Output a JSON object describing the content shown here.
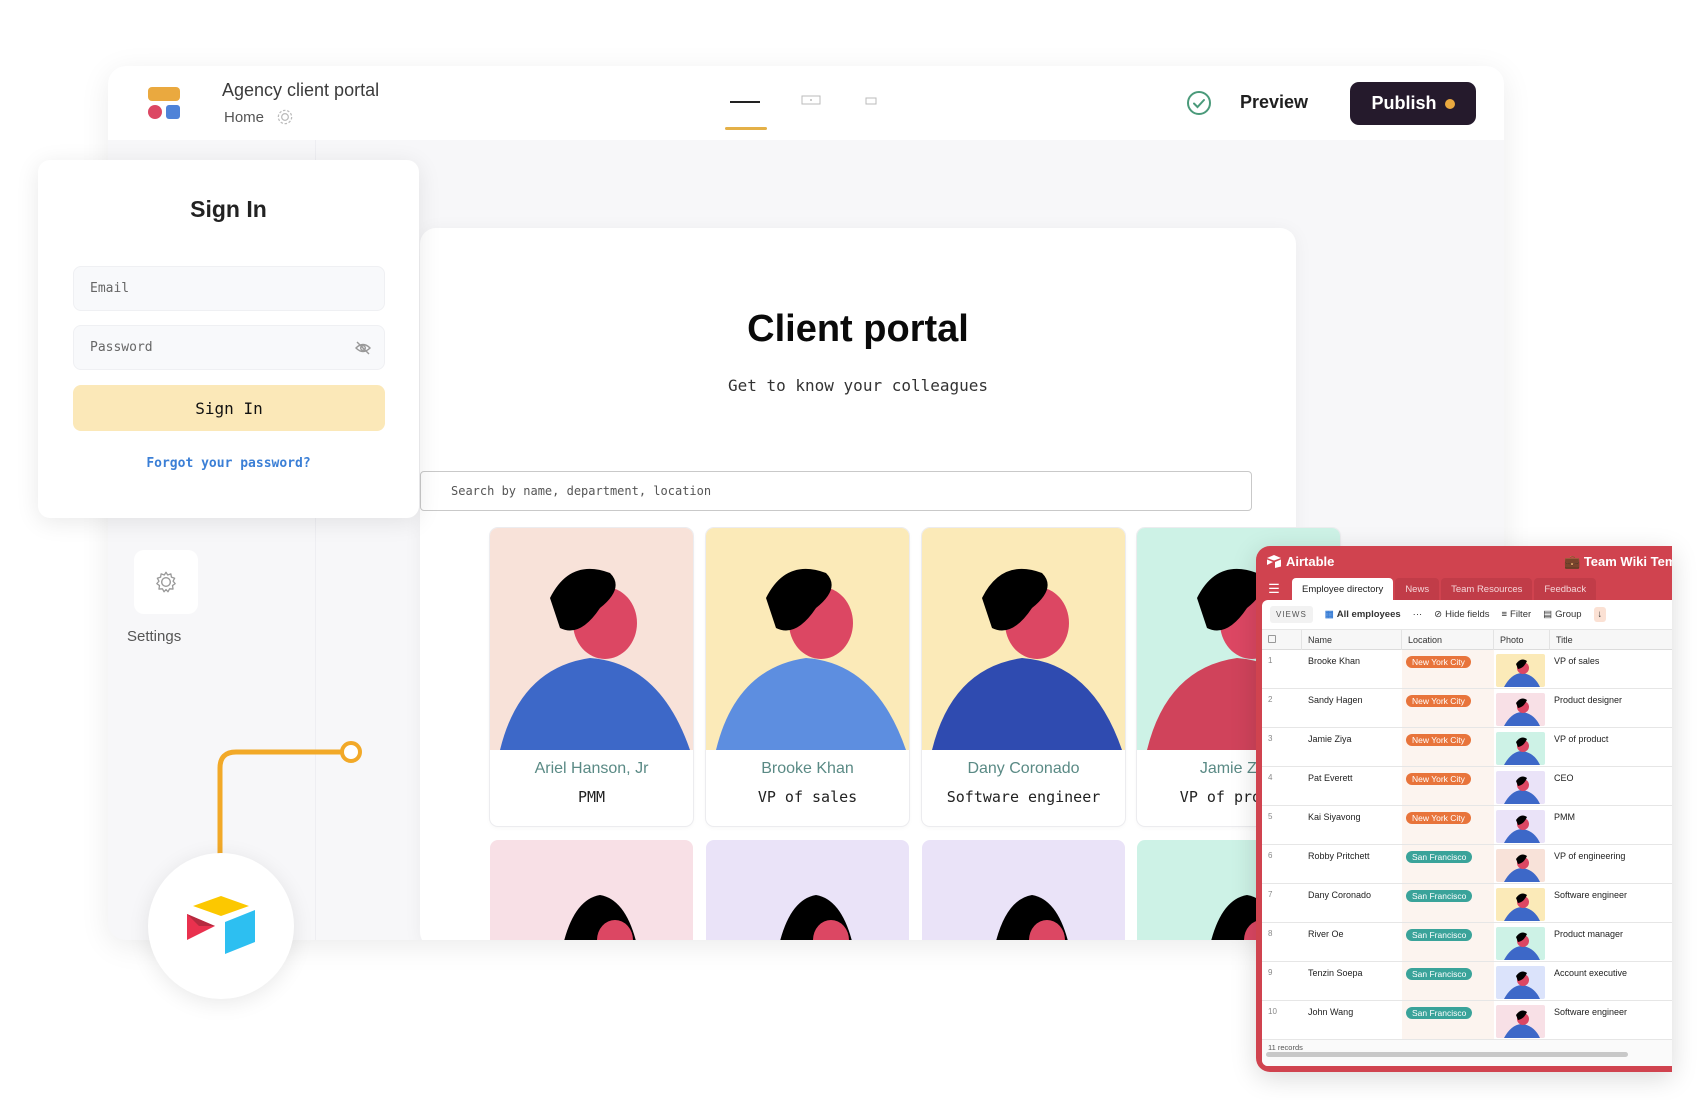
{
  "app": {
    "title": "Agency client portal",
    "breadcrumb": "Home",
    "preview_label": "Preview",
    "publish_label": "Publish",
    "colors": {
      "accent": "#eaa93f",
      "publish_bg": "#251a2c",
      "check": "#4a9a7a"
    }
  },
  "sidebar": {
    "items": [
      {
        "label": "Settings",
        "icon": "gear-icon"
      }
    ]
  },
  "signin": {
    "title": "Sign In",
    "email_placeholder": "Email",
    "password_placeholder": "Password",
    "button_label": "Sign In",
    "forgot_label": "Forgot your password?"
  },
  "portal": {
    "title": "Client portal",
    "subtitle": "Get to know your colleagues",
    "search_placeholder": "Search by name, department, location",
    "cards": [
      {
        "name": "Ariel Hanson, Jr",
        "role": "PMM",
        "bg": "#f8e2d9"
      },
      {
        "name": "Brooke Khan",
        "role": "VP of sales",
        "bg": "#fbeab8"
      },
      {
        "name": "Dany Coronado",
        "role": "Software engineer",
        "bg": "#fbeab8"
      },
      {
        "name": "Jamie Ziya",
        "role": "VP of product",
        "bg": "#cdf2e6"
      }
    ],
    "cards_row2_bg": [
      "#f8e0e6",
      "#eae3f8",
      "#eae3f8",
      "#cdf2e6"
    ]
  },
  "airtable": {
    "brand": "Airtable",
    "base_name": "Team Wiki Tem",
    "tabs": [
      "Employee directory",
      "News",
      "Team Resources",
      "Feedback"
    ],
    "active_tab": 0,
    "toolbar": {
      "views": "VIEWS",
      "view_name": "All employees",
      "more": "···",
      "hide_fields": "Hide fields",
      "filter": "Filter",
      "group": "Group"
    },
    "columns": [
      "Name",
      "Location",
      "Photo",
      "Title"
    ],
    "rows": [
      {
        "n": "1",
        "name": "Brooke Khan",
        "location": "New York City",
        "title": "VP of sales",
        "photo_bg": "#fbeab8"
      },
      {
        "n": "2",
        "name": "Sandy Hagen",
        "location": "New York City",
        "title": "Product designer",
        "photo_bg": "#f8e0e6"
      },
      {
        "n": "3",
        "name": "Jamie Ziya",
        "location": "New York City",
        "title": "VP of product",
        "photo_bg": "#cdf2e6"
      },
      {
        "n": "4",
        "name": "Pat Everett",
        "location": "New York City",
        "title": "CEO",
        "photo_bg": "#eae3f8"
      },
      {
        "n": "5",
        "name": "Kai Siyavong",
        "location": "New York City",
        "title": "PMM",
        "photo_bg": "#eae3f8"
      },
      {
        "n": "6",
        "name": "Robby Pritchett",
        "location": "San Francisco",
        "title": "VP of engineering",
        "photo_bg": "#f8e2d9"
      },
      {
        "n": "7",
        "name": "Dany Coronado",
        "location": "San Francisco",
        "title": "Software engineer",
        "photo_bg": "#fbeab8"
      },
      {
        "n": "8",
        "name": "River Oe",
        "location": "San Francisco",
        "title": "Product manager",
        "photo_bg": "#cdf2e6"
      },
      {
        "n": "9",
        "name": "Tenzin Soepa",
        "location": "San Francisco",
        "title": "Account executive",
        "photo_bg": "#dbe3fb"
      },
      {
        "n": "10",
        "name": "John Wang",
        "location": "San Francisco",
        "title": "Software engineer",
        "photo_bg": "#f8e0e6"
      }
    ],
    "location_colors": {
      "New York City": "#e8743b",
      "San Francisco": "#3aa39a"
    },
    "footer": "11 records"
  }
}
